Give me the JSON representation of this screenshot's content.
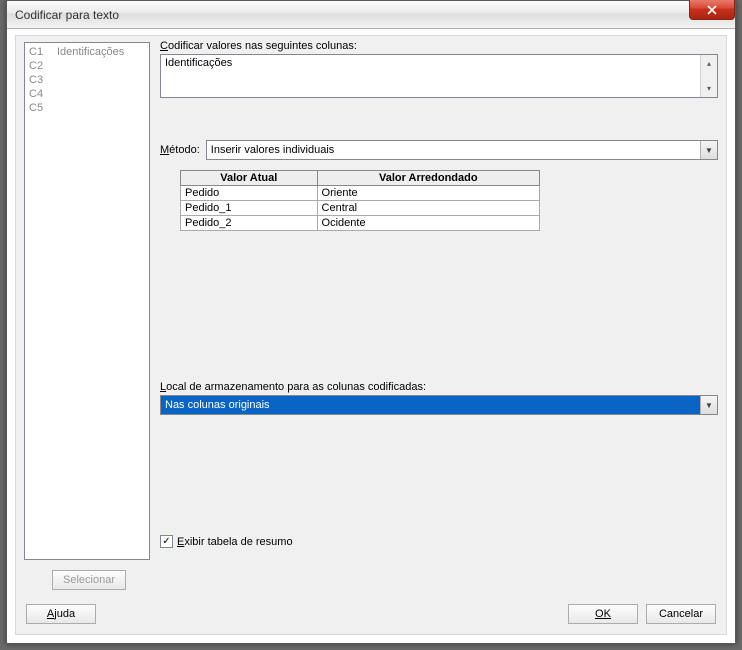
{
  "window": {
    "title": "Codificar para texto"
  },
  "columns": [
    {
      "id": "C1",
      "name": "Identificações"
    },
    {
      "id": "C2",
      "name": ""
    },
    {
      "id": "C3",
      "name": ""
    },
    {
      "id": "C4",
      "name": ""
    },
    {
      "id": "C5",
      "name": ""
    }
  ],
  "buttons": {
    "selecionar": "Selecionar",
    "ajuda": "Ajuda",
    "ok": "OK",
    "cancelar": "Cancelar"
  },
  "labels": {
    "codificar_valores": "Codificar valores nas seguintes colunas:",
    "metodo": "Método:",
    "local_armazenamento": "Local de armazenamento para as colunas codificadas:",
    "exibir_resumo": "Exibir tabela de resumo"
  },
  "columns_textarea": "Identificações",
  "metodo_value": "Inserir valores individuais",
  "values_table": {
    "headers": [
      "Valor Atual",
      "Valor Arredondado"
    ],
    "rows": [
      [
        "Pedido",
        "Oriente"
      ],
      [
        "Pedido_1",
        "Central"
      ],
      [
        "Pedido_2",
        "Ocidente"
      ]
    ]
  },
  "storage_value": "Nas colunas originais",
  "chk_checked": "✓"
}
